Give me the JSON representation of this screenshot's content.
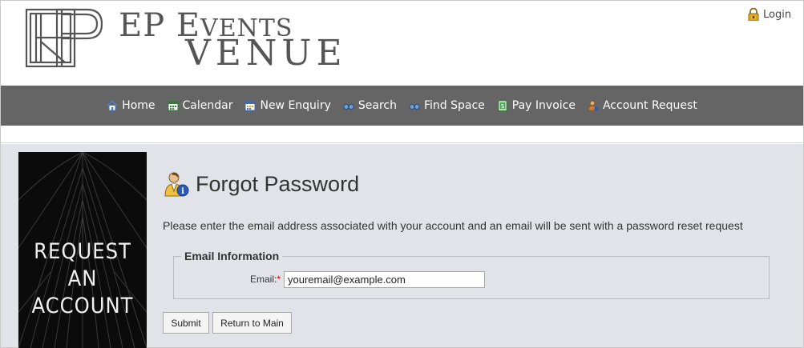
{
  "brand": {
    "line1_cap_e": "E",
    "line1_cap_p": "P",
    "line1_cap_e2": "E",
    "line1_rest": "VENTS",
    "line2": "VENUE"
  },
  "header": {
    "login_label": "Login"
  },
  "nav": {
    "items": [
      {
        "label": "Home",
        "icon": "home-icon"
      },
      {
        "label": "Calendar",
        "icon": "calendar-icon"
      },
      {
        "label": "New Enquiry",
        "icon": "enquiry-icon"
      },
      {
        "label": "Search",
        "icon": "binoculars-icon"
      },
      {
        "label": "Find Space",
        "icon": "binoculars-icon"
      },
      {
        "label": "Pay Invoice",
        "icon": "invoice-icon"
      },
      {
        "label": "Account Request",
        "icon": "account-icon"
      }
    ]
  },
  "banner": {
    "line1": "REQUEST",
    "line2": "AN",
    "line3": "ACCOUNT"
  },
  "page": {
    "title": "Forgot Password",
    "intro": "Please enter the email address associated with your account and an email will be sent with a password reset request"
  },
  "form": {
    "legend": "Email Information",
    "email_label": "Email:",
    "required_mark": "*",
    "email_value": "youremail@example.com"
  },
  "buttons": {
    "submit": "Submit",
    "return": "Return to Main"
  },
  "colors": {
    "nav_bg": "#656565",
    "content_bg": "#e1e3e8",
    "brand_text": "#555555"
  }
}
